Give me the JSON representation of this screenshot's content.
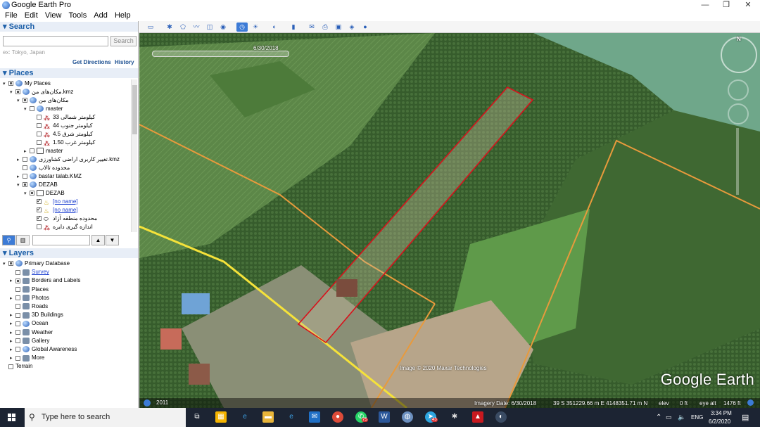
{
  "window": {
    "title": "Google Earth Pro",
    "controls": [
      "—",
      "❐",
      "✕"
    ]
  },
  "menu": [
    "File",
    "Edit",
    "View",
    "Tools",
    "Add",
    "Help"
  ],
  "search": {
    "header": "Search",
    "placeholder": "",
    "button": "Search",
    "hint": "ex: Tokyo, Japan",
    "get_directions": "Get Directions",
    "history": "History"
  },
  "places": {
    "header": "Places",
    "items": [
      {
        "label": "My Places",
        "depth": 0,
        "exp": "▾",
        "check": "partial",
        "icon": "globe-icon"
      },
      {
        "label": "مکان‌های من.kmz",
        "depth": 1,
        "exp": "▾",
        "check": "partial",
        "icon": "globe-icon"
      },
      {
        "label": "مکان‌های من",
        "depth": 2,
        "exp": "▾",
        "check": "partial",
        "icon": "globe-icon"
      },
      {
        "label": "master",
        "depth": 3,
        "exp": "▾",
        "check": "none",
        "icon": "globe-icon"
      },
      {
        "label": "کیلومتر شمالی 33",
        "depth": 4,
        "exp": "",
        "check": "none",
        "icon": "pin-icon"
      },
      {
        "label": "کیلومتر جنوب 44",
        "depth": 4,
        "exp": "",
        "check": "none",
        "icon": "pin-icon"
      },
      {
        "label": "کیلومتر شرق 4.5",
        "depth": 4,
        "exp": "",
        "check": "none",
        "icon": "pin-icon"
      },
      {
        "label": "کیلومتر غرب 1.50",
        "depth": 4,
        "exp": "",
        "check": "none",
        "icon": "pin-icon"
      },
      {
        "label": "master",
        "depth": 3,
        "exp": "▸",
        "check": "none",
        "icon": "folder-icon"
      },
      {
        "label": "تغییر کاربری اراضی کشاورزی.kmz",
        "depth": 2,
        "exp": "▸",
        "check": "none",
        "icon": "globe-icon"
      },
      {
        "label": "محدوده تالاب",
        "depth": 2,
        "exp": "",
        "check": "none",
        "icon": "globe-icon"
      },
      {
        "label": "bastar talab.KMZ",
        "depth": 2,
        "exp": "▸",
        "check": "none",
        "icon": "globe-icon"
      },
      {
        "label": "DEZAB",
        "depth": 2,
        "exp": "▾",
        "check": "partial",
        "icon": "globe-icon"
      },
      {
        "label": "DEZAB",
        "depth": 3,
        "exp": "▾",
        "check": "partial",
        "icon": "folder-icon"
      },
      {
        "label": "[no name]",
        "depth": 4,
        "exp": "",
        "check": "checked",
        "icon": "path-icon",
        "link": true
      },
      {
        "label": "[no name]",
        "depth": 4,
        "exp": "",
        "check": "checked",
        "icon": "path-icon",
        "link": true
      },
      {
        "label": "محدوده منطقه آزاد",
        "depth": 4,
        "exp": "",
        "check": "checked",
        "icon": "polygon-icon"
      },
      {
        "label": "اندازه گیری دایره",
        "depth": 4,
        "exp": "",
        "check": "none",
        "icon": "pin-icon"
      }
    ]
  },
  "layers": {
    "header": "Layers",
    "items": [
      {
        "label": "Primary Database",
        "exp": "▾",
        "check": "partial",
        "icon": "database-icon",
        "depth": 0
      },
      {
        "label": "Survey",
        "exp": "",
        "check": "none",
        "icon": "survey-icon",
        "depth": 1,
        "link": true
      },
      {
        "label": "Borders and Labels",
        "exp": "▸",
        "check": "partial",
        "icon": "flag-icon",
        "depth": 1
      },
      {
        "label": "Places",
        "exp": "",
        "check": "none",
        "icon": "places-icon",
        "depth": 1
      },
      {
        "label": "Photos",
        "exp": "▸",
        "check": "none",
        "icon": "photos-icon",
        "depth": 1
      },
      {
        "label": "Roads",
        "exp": "",
        "check": "none",
        "icon": "roads-icon",
        "depth": 1
      },
      {
        "label": "3D Buildings",
        "exp": "▸",
        "check": "none",
        "icon": "buildings-icon",
        "depth": 1
      },
      {
        "label": "Ocean",
        "exp": "▸",
        "check": "none",
        "icon": "ocean-icon",
        "depth": 1
      },
      {
        "label": "Weather",
        "exp": "▸",
        "check": "none",
        "icon": "weather-icon",
        "depth": 1
      },
      {
        "label": "Gallery",
        "exp": "▸",
        "check": "none",
        "icon": "gallery-icon",
        "depth": 1
      },
      {
        "label": "Global Awareness",
        "exp": "▸",
        "check": "none",
        "icon": "awareness-icon",
        "depth": 1
      },
      {
        "label": "More",
        "exp": "▸",
        "check": "none",
        "icon": "more-icon",
        "depth": 1
      },
      {
        "label": "Terrain",
        "exp": "",
        "check": "none",
        "icon": "",
        "depth": 0
      }
    ]
  },
  "map": {
    "time_slider_date": "6/30/2018",
    "copyright": "Image © 2020 Maxar Technologies",
    "logo": "Google Earth",
    "historical_year": "2011",
    "imagery_date": "Imagery Date: 6/30/2018",
    "coords": "39 S 351229.66 m E 4148351.71 m N",
    "elev": "elev",
    "elev_val": "0 ft",
    "eye_alt": "eye alt",
    "eye_alt_val": "1476 ft",
    "compass_n": "N"
  },
  "taskbar": {
    "search_placeholder": "Type here to search",
    "time": "3:34 PM",
    "date": "6/2/2020",
    "lang": "ENG",
    "badges": {
      "whatsapp": "75",
      "telegram": "43"
    }
  },
  "colors": {
    "polygon": "#d8111b",
    "road_yellow": "#f5e23a",
    "boundary_orange": "#e89a3c"
  }
}
